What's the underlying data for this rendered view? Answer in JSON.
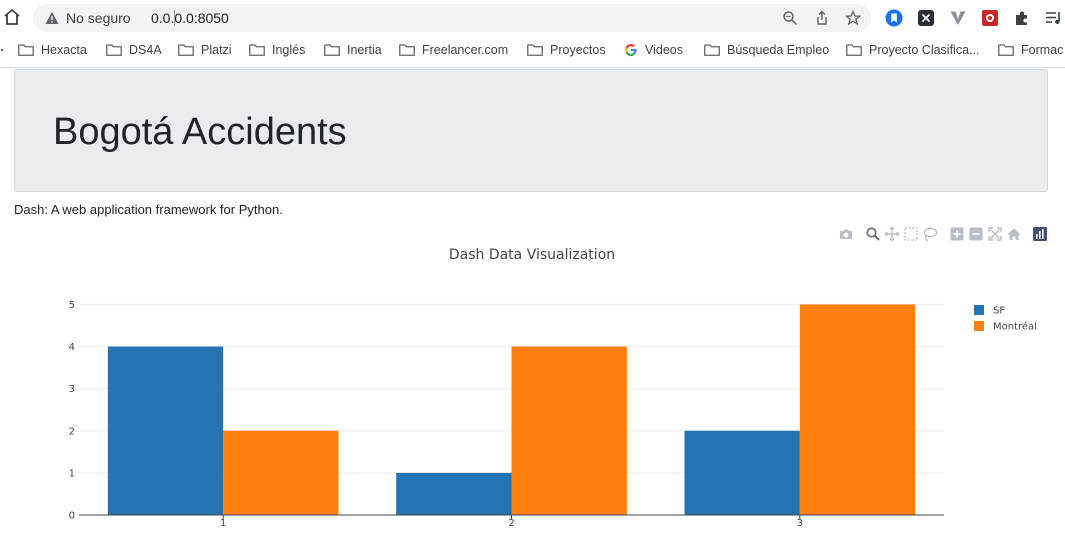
{
  "browser": {
    "security_label": "No seguro",
    "url": "0.0.0.0:8050",
    "bookmarks": [
      {
        "label": "Hexacta",
        "icon": "folder-icon"
      },
      {
        "label": "DS4A",
        "icon": "folder-icon"
      },
      {
        "label": "Platzi",
        "icon": "folder-icon"
      },
      {
        "label": "Inglés",
        "icon": "folder-icon"
      },
      {
        "label": "Inertia",
        "icon": "folder-icon"
      },
      {
        "label": "Freelancer.com",
        "icon": "folder-icon"
      },
      {
        "label": "Proyectos",
        "icon": "folder-icon"
      },
      {
        "label": "Videos",
        "icon": "google-icon"
      },
      {
        "label": "Búsqueda Empleo",
        "icon": "folder-icon"
      },
      {
        "label": "Proyecto Clasifica...",
        "icon": "folder-icon"
      },
      {
        "label": "Formac",
        "icon": "folder-icon"
      }
    ]
  },
  "page": {
    "title": "Bogotá Accidents",
    "subtitle": "Dash: A web application framework for Python."
  },
  "modebar": [
    "camera-icon",
    "zoom-icon",
    "pan-icon",
    "box-select-icon",
    "lasso-icon",
    "zoom-in-icon",
    "zoom-out-icon",
    "autoscale-icon",
    "reset-axes-icon",
    "plotly-logo-icon"
  ],
  "chart_data": {
    "type": "bar",
    "title": "Dash Data Visualization",
    "categories": [
      1,
      2,
      3
    ],
    "series": [
      {
        "name": "SF",
        "values": [
          4,
          1,
          2
        ],
        "color": "#2474b4"
      },
      {
        "name": "Montréal",
        "values": [
          2,
          4,
          5
        ],
        "color": "#ff7f0e"
      }
    ],
    "y_ticks": [
      0,
      1,
      2,
      3,
      4,
      5
    ],
    "ylim": [
      0,
      5.2
    ],
    "grid": true,
    "legend_position": "top-right"
  }
}
